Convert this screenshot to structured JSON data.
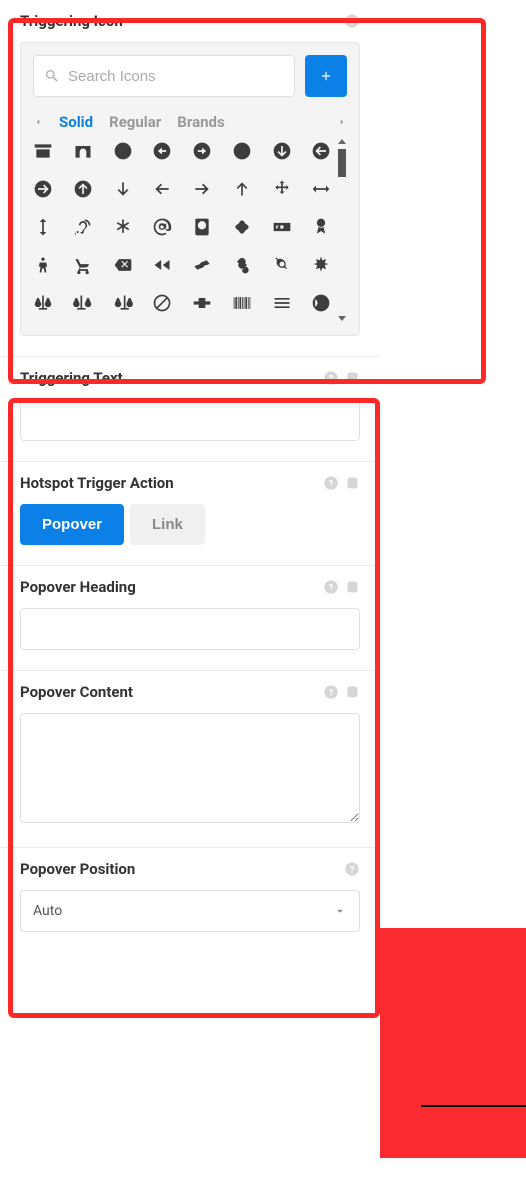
{
  "sections": {
    "triggering_icon": {
      "title": "Triggering Icon",
      "search_placeholder": "Search Icons",
      "tabs": {
        "solid": "Solid",
        "regular": "Regular",
        "brands": "Brands"
      },
      "icons": [
        "archive",
        "archway",
        "arrow-alt-circle-down",
        "arrow-alt-circle-left",
        "arrow-alt-circle-right",
        "arrow-alt-circle-up",
        "arrow-circle-down",
        "arrow-circle-left",
        "arrow-circle-right",
        "arrow-circle-up",
        "arrow-down",
        "arrow-left",
        "arrow-right",
        "arrow-up",
        "arrows-alt",
        "arrows-alt-h",
        "arrows-alt-v",
        "assistive-listening",
        "asterisk",
        "at",
        "atlas",
        "atom",
        "audio-description",
        "award",
        "baby",
        "baby-carriage",
        "backspace",
        "backward",
        "bacon",
        "bacteria",
        "bacterium",
        "bahai",
        "balance-scale",
        "balance-scale-left",
        "balance-scale-right",
        "ban",
        "band-aid",
        "barcode",
        "bars",
        "baseball-ball"
      ]
    },
    "triggering_text": {
      "title": "Triggering Text",
      "value": ""
    },
    "hotspot_trigger": {
      "title": "Hotspot Trigger Action",
      "options": {
        "popover": "Popover",
        "link": "Link"
      }
    },
    "popover_heading": {
      "title": "Popover Heading",
      "value": ""
    },
    "popover_content": {
      "title": "Popover Content",
      "value": ""
    },
    "popover_position": {
      "title": "Popover Position",
      "value": "Auto"
    }
  }
}
